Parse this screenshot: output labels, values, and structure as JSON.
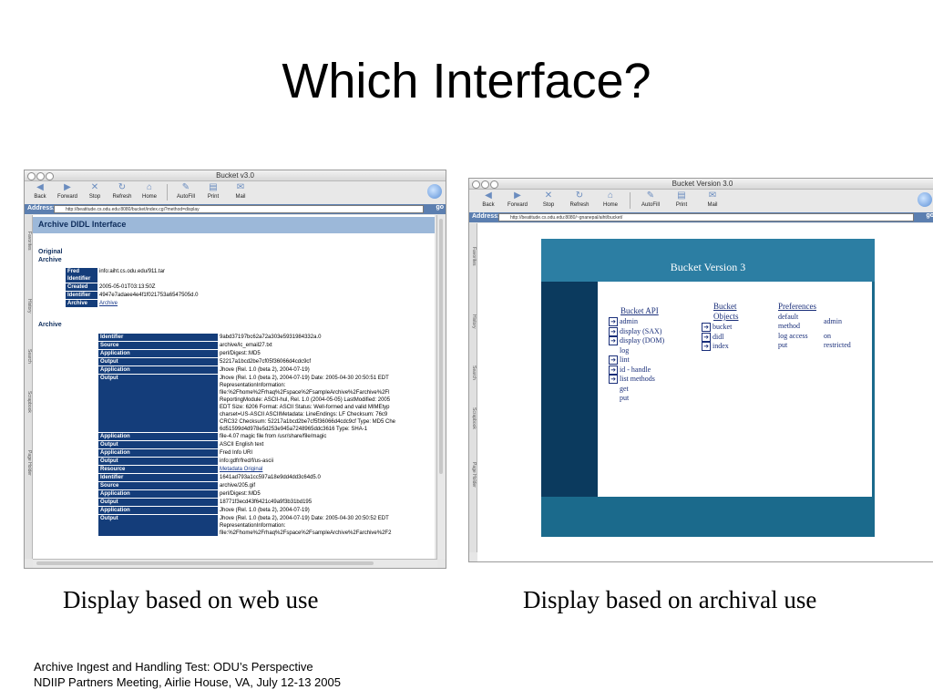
{
  "slide": {
    "title": "Which Interface?",
    "caption_left": "Display based on web use",
    "caption_right": "Display based on archival use",
    "footer_line1": "Archive Ingest and Handling Test: ODU’s Perspective",
    "footer_line2": "NDIIP Partners Meeting, Airlie House, VA, July 12-13 2005"
  },
  "browser_common": {
    "toolbar": [
      "Back",
      "Forward",
      "Stop",
      "Refresh",
      "Home",
      "AutoFill",
      "Print",
      "Mail"
    ],
    "address_label": "Address:",
    "go_label": "go",
    "sidetabs": [
      "Favorites",
      "History",
      "Search",
      "Scrapbook",
      "Page Holder"
    ]
  },
  "left_window": {
    "title": "Bucket v3.0",
    "address": "http://beatitude.cs.odu.edu:8080/bucket/index.cgi?method=display",
    "heading": "Archive DIDL Interface",
    "original_label": "Original",
    "archive_label": "Archive",
    "original_rows": [
      {
        "k": "Fred Identifier",
        "v": "info:aiht.cs.odu.edu/911.tar"
      },
      {
        "k": "Created",
        "v": "2005-05-01T03:13:50Z"
      },
      {
        "k": "Identifier",
        "v": "4947e7adaee4e4f1f021753a6547505d.0"
      },
      {
        "k": "Archive",
        "v": "Archive"
      }
    ],
    "archive_section": "Archive",
    "archive_rows": [
      {
        "k": "Identifier",
        "v": "9abd37197bc62a72a303e5931984332a.0"
      },
      {
        "k": "Source",
        "v": "archive/lc_email27.txt"
      },
      {
        "k": "Application",
        "v": "perl/Digest::MD5"
      },
      {
        "k": "Output",
        "v": "52217a1bcd2be7cf05f36066d4cdc9cf"
      },
      {
        "k": "Application",
        "v": "Jhove (Rel. 1.0 (beta 2), 2004-07-19)"
      },
      {
        "k": "Output",
        "v": "Jhove (Rel. 1.0 (beta 2), 2004-07-19) Date: 2005-04-30 20:50:51 EDT\nRepresentationInformation:\nfile:%2Fhome%2Frhaq%2Fspace%2FsampleArchive%2Farchive%2Fl\nReportingModule: ASCII-hul, Rel. 1.0 (2004-05-05) LastModified: 2005\nEDT Size: 6206 Format: ASCII Status: Well-formed and valid MIMEtyp\ncharset=US-ASCII ASCIIMetadata: LineEndings: LF Checksum: 76c9\nCRC32 Checksum: 52217a1bcd2be7cf5f36066d4cdc9cf Type: MD5 Che\n6d51599d4d978e5d253e945a7248965ddc3616 Type: SHA-1"
      },
      {
        "k": "Application",
        "v": "file-4.07 magic file from /usr/share/file/magic"
      },
      {
        "k": "Output",
        "v": "ASCII English text"
      },
      {
        "k": "Application",
        "v": "Fred Info URI"
      },
      {
        "k": "Output",
        "v": "info:gdfr/fred/f/us-ascii"
      },
      {
        "k": "Resource",
        "v": "Metadata Original"
      },
      {
        "k": "Identifier",
        "v": "1641ad793a1cc597a18e9dd4dd3c64d5.0"
      },
      {
        "k": "Source",
        "v": "archive/205.gif"
      },
      {
        "k": "Application",
        "v": "perl/Digest::MD5"
      },
      {
        "k": "Output",
        "v": "18771f3ecd43f6421c49a9f3b31bd195"
      },
      {
        "k": "Application",
        "v": "Jhove (Rel. 1.0 (beta 2), 2004-07-19)"
      },
      {
        "k": "Output",
        "v": "Jhove (Rel. 1.0 (beta 2), 2004-07-19) Date: 2005-04-30 20:50:52 EDT\nRepresentationInformation:\nfile:%2Fhome%2Frhaq%2Fspace%2FsampleArchive%2Farchive%2F2"
      }
    ]
  },
  "right_window": {
    "title": "Bucket Version 3.0",
    "address": "http://beatitude.cs.odu.edu:8080/~gnanepal/aiht/bucket/",
    "page_title": "Bucket Version 3",
    "api_heading": "Bucket API",
    "api_items": [
      {
        "label": "admin",
        "arrow": true
      },
      {
        "label": "display (SAX)",
        "arrow": true
      },
      {
        "label": "display (DOM)",
        "arrow": true
      },
      {
        "label": "log",
        "arrow": false
      },
      {
        "label": "lint",
        "arrow": true
      },
      {
        "label": "id - handle",
        "arrow": true
      },
      {
        "label": "list methods",
        "arrow": true
      },
      {
        "label": "get",
        "arrow": false
      },
      {
        "label": "put",
        "arrow": false
      }
    ],
    "objects_heading_1": "Bucket",
    "objects_heading_2": "Objects",
    "object_items": [
      "bucket",
      "didl",
      "index"
    ],
    "prefs_heading": "Preferences",
    "prefs": [
      {
        "k": "default method",
        "v": "admin"
      },
      {
        "k": "log access",
        "v": "on"
      },
      {
        "k": "put",
        "v": "restricted"
      }
    ]
  }
}
